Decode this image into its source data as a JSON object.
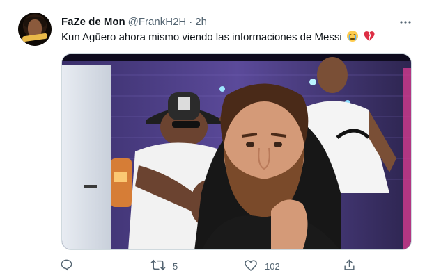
{
  "tweet": {
    "author_name": "FaZe de Mon",
    "handle": "@FrankH2H",
    "separator": "·",
    "time": "2h",
    "text": "Kun Agüero ahora mismo viendo las informaciones de Messi",
    "emojis": [
      "crying-face-emoji",
      "broken-heart-emoji"
    ],
    "media_description_icon": "photo"
  },
  "actions": {
    "reply_count": "",
    "retweet_count": "5",
    "like_count": "102",
    "share_count": ""
  },
  "icons": {
    "more": "more-options-icon",
    "reply": "reply-icon",
    "retweet": "retweet-icon",
    "like": "heart-icon",
    "share": "share-icon"
  },
  "colors": {
    "text_primary": "#0f1419",
    "text_secondary": "#536471",
    "border": "#cfd9de"
  }
}
